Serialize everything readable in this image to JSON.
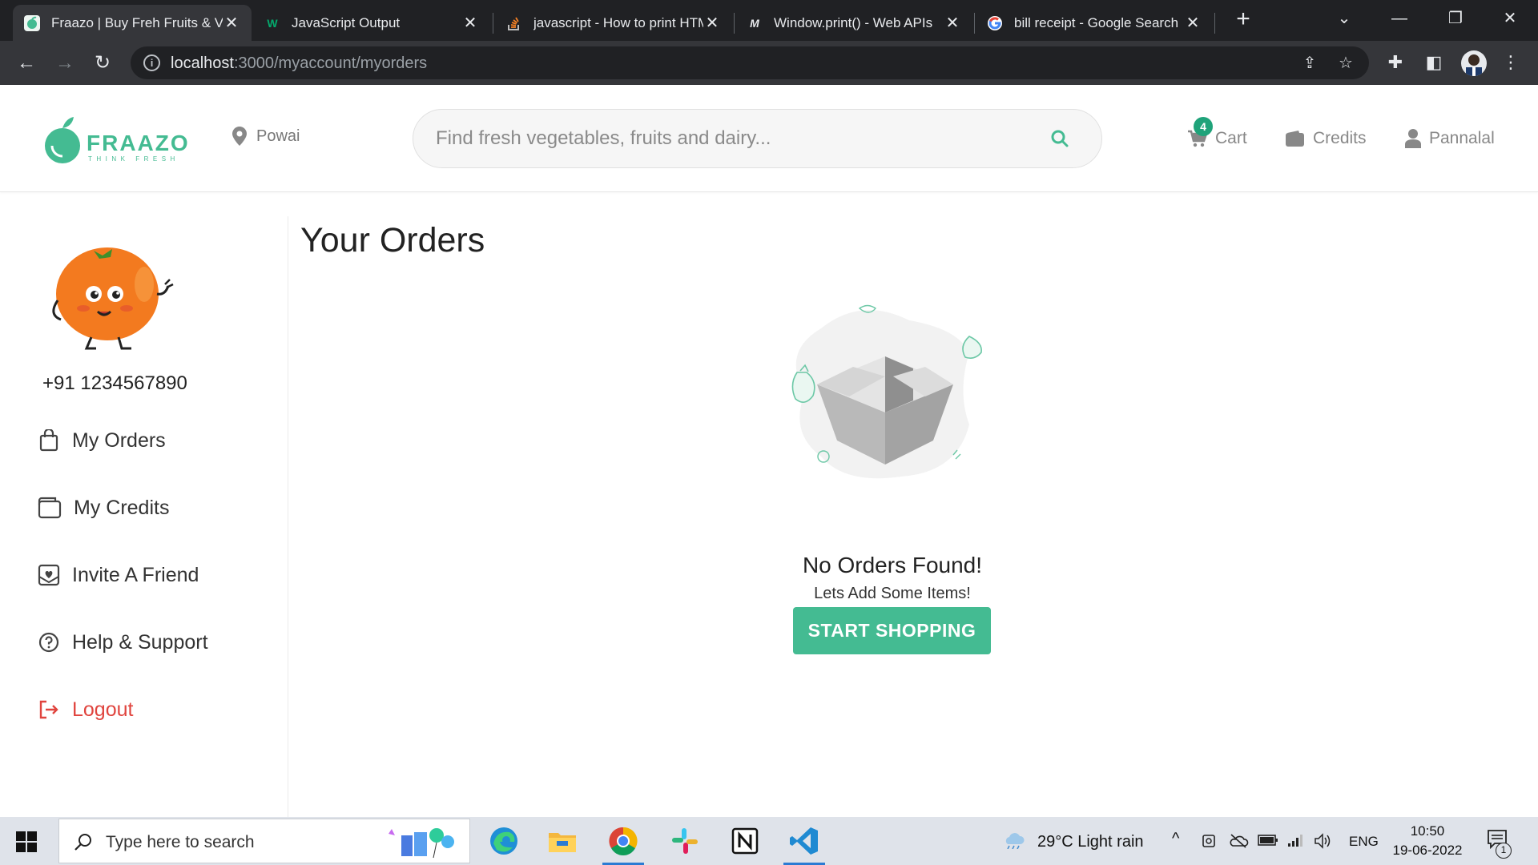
{
  "browser": {
    "tabs": [
      {
        "title": "Fraazo | Buy Freh Fruits & Vegetables Online",
        "active": true,
        "favicon": "fraazo-icon"
      },
      {
        "title": "JavaScript Output",
        "active": false,
        "favicon": "w3schools-icon"
      },
      {
        "title": "javascript - How to print HTML content",
        "active": false,
        "favicon": "stackoverflow-icon"
      },
      {
        "title": "Window.print() - Web APIs",
        "active": false,
        "favicon": "mdn-icon"
      },
      {
        "title": "bill receipt - Google Search",
        "active": false,
        "favicon": "google-icon"
      }
    ],
    "url_host": "localhost",
    "url_path": ":3000/myaccount/myorders"
  },
  "header": {
    "location": "Powai",
    "search_placeholder": "Find fresh vegetables, fruits and dairy...",
    "cart_label": "Cart",
    "cart_count": "4",
    "credits_label": "Credits",
    "user_label": "Pannalal",
    "accent_color": "#44bb92"
  },
  "sidebar": {
    "phone": "+91 1234567890",
    "items": [
      {
        "label": "My Orders",
        "icon": "shopping-bag-icon"
      },
      {
        "label": "My Credits",
        "icon": "wallet-icon"
      },
      {
        "label": "Invite A Friend",
        "icon": "invite-icon"
      },
      {
        "label": "Help & Support",
        "icon": "help-icon"
      },
      {
        "label": "Logout",
        "icon": "logout-icon"
      }
    ]
  },
  "main": {
    "title": "Your Orders",
    "empty_title": "No Orders Found!",
    "empty_subtitle": "Lets Add Some Items!",
    "cta_label": "START SHOPPING"
  },
  "taskbar": {
    "search_placeholder": "Type here to search",
    "weather": "29°C  Light rain",
    "language": "ENG",
    "time": "10:50",
    "date": "19-06-2022",
    "notifications": "1"
  }
}
